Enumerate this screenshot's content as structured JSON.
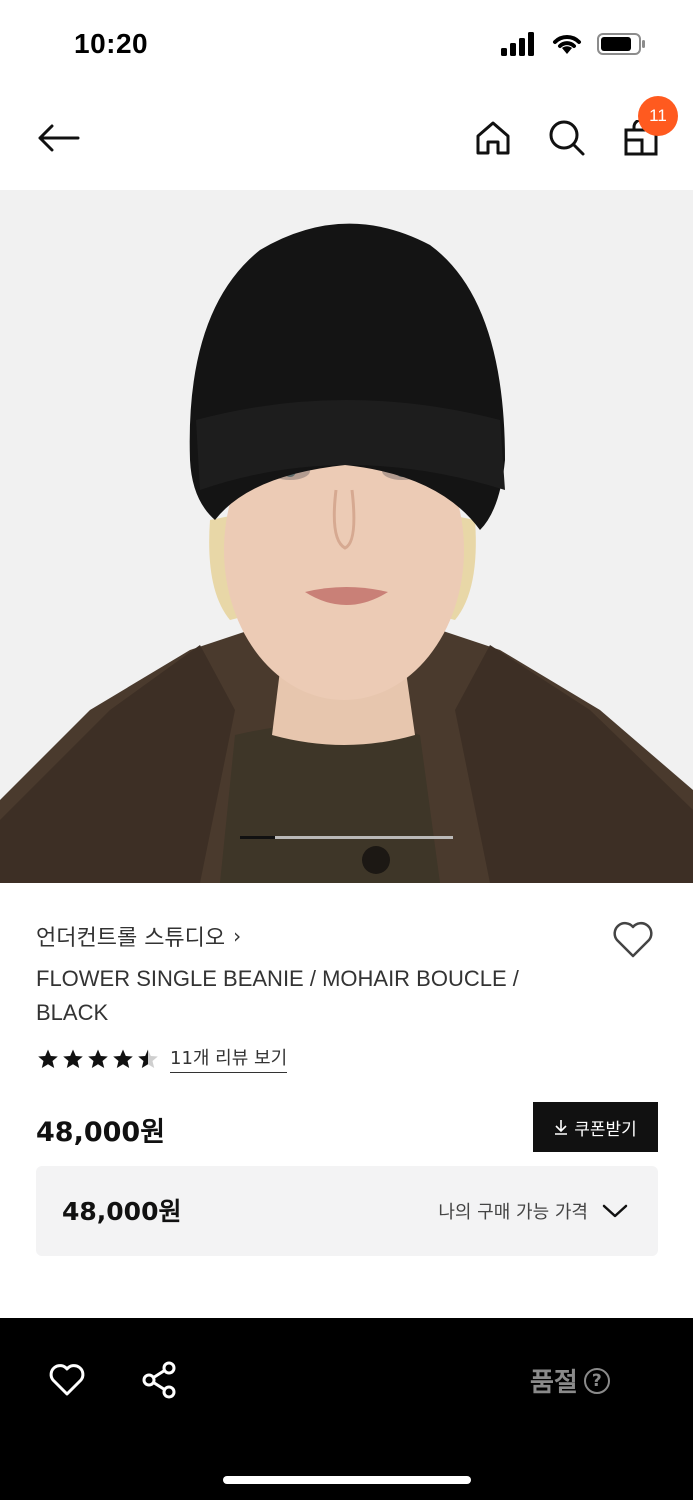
{
  "status_bar": {
    "time": "10:20",
    "icons": [
      "signal-icon",
      "wifi-icon",
      "battery-icon"
    ]
  },
  "nav": {
    "icons": [
      "back-arrow-icon",
      "home-icon",
      "search-icon",
      "shopping-bag-icon"
    ],
    "cart_count": "11",
    "badge_color": "#ff5a1f"
  },
  "hero": {
    "image": "model-wearing-black-beanie",
    "slide_index": 1,
    "slide_count": 6
  },
  "product": {
    "brand": "언더컨트롤 스튜디오",
    "brand_chevron": "›",
    "title": "FLOWER SINGLE BEANIE / MOHAIR BOUCLE / BLACK",
    "rating": 4.5,
    "review_link": "11개 리뷰 보기",
    "price": "48,000원",
    "coupon_label": "쿠폰받기"
  },
  "my_price": {
    "value": "48,000원",
    "label": "나의 구매 가능 가격"
  },
  "bottom_bar": {
    "soldout_label": "품절",
    "help": "?"
  },
  "colors": {
    "accent": "#ff5a1f",
    "bottom_bar_bg": "#000000",
    "soldout_text": "#8a8a8a"
  }
}
